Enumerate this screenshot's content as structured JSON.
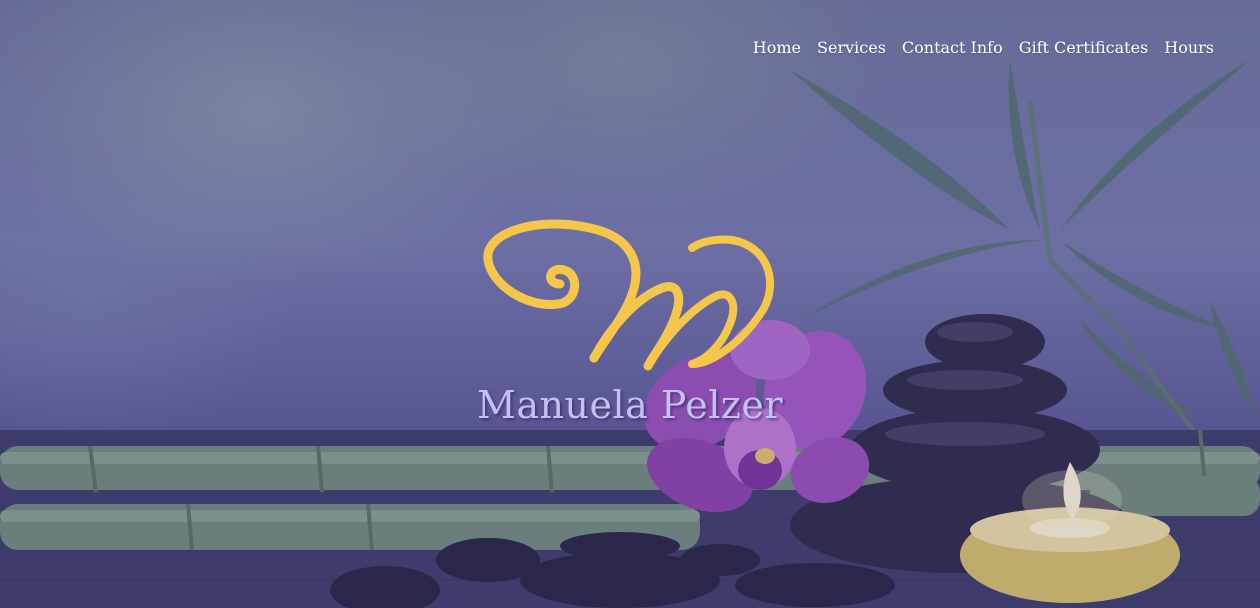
{
  "nav": {
    "items": [
      {
        "label": "Home"
      },
      {
        "label": "Services"
      },
      {
        "label": "Contact Info"
      },
      {
        "label": "Gift Certificates"
      },
      {
        "label": "Hours"
      }
    ]
  },
  "hero": {
    "brand_name": "Manuela Pelzer"
  },
  "colors": {
    "logo_gold": "#f4c64a",
    "brand_text": "#c6bff2",
    "nav_text": "#ffffff",
    "overlay_purple": "#5a5b93"
  },
  "icons": {
    "logo": "script-m-monogram"
  }
}
